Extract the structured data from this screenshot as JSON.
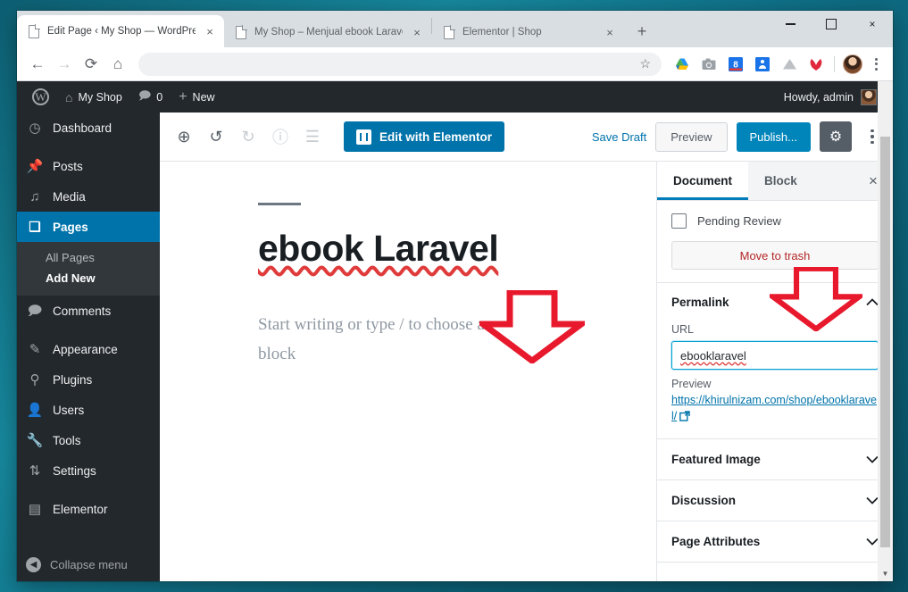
{
  "browser": {
    "tabs": [
      {
        "title": "Edit Page ‹ My Shop — WordPres",
        "active": true,
        "favicon": "document-icon",
        "close": "×"
      },
      {
        "title": "My Shop – Menjual ebook Larave",
        "active": false,
        "favicon": "document-icon",
        "close": "×"
      },
      {
        "title": "Elementor | Shop",
        "active": false,
        "favicon": "document-icon",
        "close": "×"
      }
    ],
    "new_tab_label": "+",
    "window_controls": {
      "minimize": "minimize-icon",
      "maximize": "maximize-icon",
      "close": "×"
    },
    "nav": {
      "back": "←",
      "forward": "→",
      "reload": "⟳",
      "home": "⌂"
    },
    "omnibox": {
      "value": "",
      "placeholder": "",
      "bookmark_star": "☆"
    },
    "extensions": [
      "google-drive-icon",
      "camera-icon",
      "grammar-extension-icon",
      "evernote-icon",
      "cloud-icon",
      "wallet-icon"
    ],
    "profile_avatar": "user-avatar",
    "menu": "chrome-menu-icon"
  },
  "wp_adminbar": {
    "logo": "wordpress-logo",
    "site_name": "My Shop",
    "comments_count": "0",
    "new_label": "New",
    "howdy": "Howdy, admin"
  },
  "sidebar": {
    "items": [
      {
        "label": "Dashboard",
        "icon": "dashboard-icon",
        "current": false
      },
      {
        "label": "Posts",
        "icon": "pin-icon",
        "current": false
      },
      {
        "label": "Media",
        "icon": "media-icon",
        "current": false
      },
      {
        "label": "Pages",
        "icon": "pages-icon",
        "current": true
      },
      {
        "label": "Comments",
        "icon": "comment-icon",
        "current": false
      },
      {
        "label": "Appearance",
        "icon": "brush-icon",
        "current": false
      },
      {
        "label": "Plugins",
        "icon": "plug-icon",
        "current": false
      },
      {
        "label": "Users",
        "icon": "user-icon",
        "current": false
      },
      {
        "label": "Tools",
        "icon": "wrench-icon",
        "current": false
      },
      {
        "label": "Settings",
        "icon": "sliders-icon",
        "current": false
      },
      {
        "label": "Elementor",
        "icon": "elementor-icon",
        "current": false
      }
    ],
    "submenu": [
      {
        "label": "All Pages",
        "current": false
      },
      {
        "label": "Add New",
        "current": true
      }
    ],
    "collapse_label": "Collapse menu",
    "collapse_icon": "collapse-left-icon"
  },
  "editor_header": {
    "add_block": "plus-circle-icon",
    "undo": "undo-icon",
    "redo": "redo-icon",
    "info": "info-icon",
    "outline": "list-icon",
    "elementor_button": "Edit with Elementor",
    "save_draft": "Save Draft",
    "preview": "Preview",
    "publish": "Publish...",
    "settings_gear": "gear-icon",
    "more_menu": "more-vertical-icon"
  },
  "canvas": {
    "title": "ebook Laravel",
    "placeholder": "Start writing or type / to choose a block"
  },
  "settings_panel": {
    "tabs": [
      {
        "label": "Document",
        "active": true
      },
      {
        "label": "Block",
        "active": false
      }
    ],
    "close_icon": "×",
    "pending_review": "Pending Review",
    "pending_checked": false,
    "move_to_trash": "Move to trash",
    "permalink": {
      "title": "Permalink",
      "expanded": true,
      "chevron": "⌃",
      "url_label": "URL",
      "url_value": "ebooklaravel",
      "preview_label": "Preview",
      "preview_url": "https://khirulnizam.com/shop/ebooklaravel/",
      "external_icon": "external-link-icon"
    },
    "sections": [
      {
        "title": "Featured Image",
        "chevron": "⌄"
      },
      {
        "title": "Discussion",
        "chevron": "⌄"
      },
      {
        "title": "Page Attributes",
        "chevron": "⌄"
      }
    ]
  },
  "annotations": {
    "arrow_color": "#e8192c",
    "arrows": [
      {
        "name": "arrow-pointing-to-title",
        "target": "post-title"
      },
      {
        "name": "arrow-pointing-to-permalink-url",
        "target": "url-input"
      }
    ]
  }
}
